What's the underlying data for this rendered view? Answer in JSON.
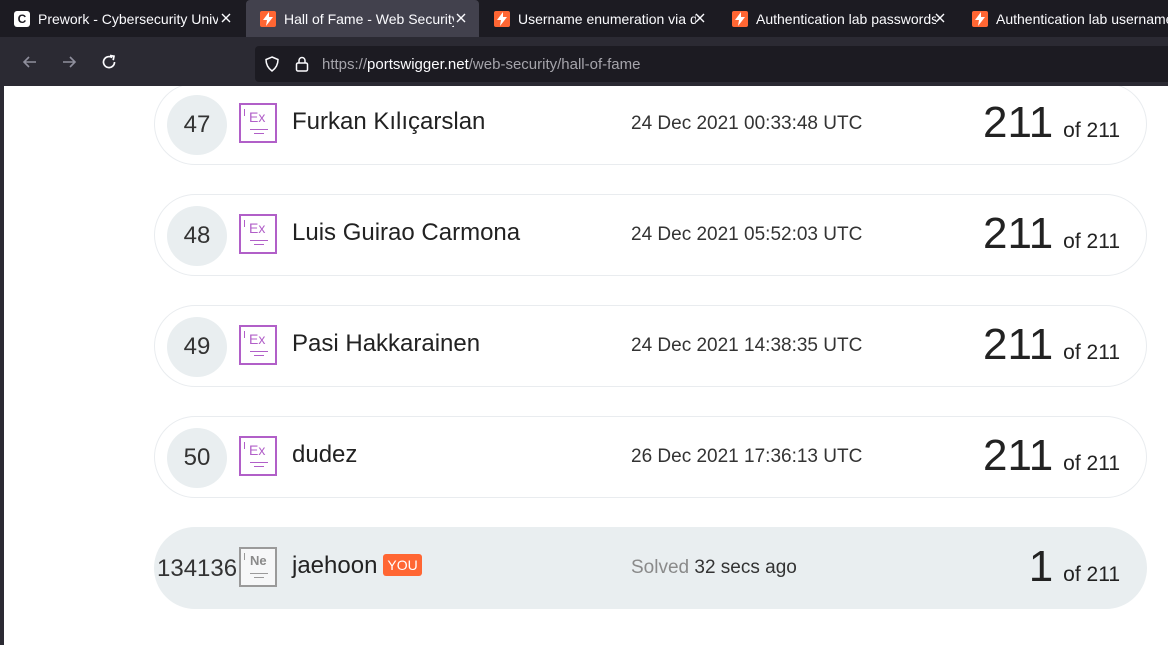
{
  "browser": {
    "tabs": [
      {
        "title": "Prework - Cybersecurity Univers",
        "favicon": "c-logo-icon",
        "active": false
      },
      {
        "title": "Hall of Fame - Web Security Ac",
        "favicon": "portswigger-icon",
        "active": true
      },
      {
        "title": "Username enumeration via diff",
        "favicon": "portswigger-icon",
        "active": false
      },
      {
        "title": "Authentication lab passwords |",
        "favicon": "portswigger-icon",
        "active": false
      },
      {
        "title": "Authentication lab usernames",
        "favicon": "portswigger-icon",
        "active": false
      }
    ],
    "url": {
      "scheme": "https://",
      "host": "portswigger.net",
      "path": "/web-security/hall-of-fame"
    }
  },
  "leaderboard": {
    "rows": [
      {
        "rank": "47",
        "badge": "Ex",
        "name": "Furkan Kılıçarslan",
        "date": "24 Dec 2021 00:33:48 UTC",
        "score": "211",
        "of": "of 211"
      },
      {
        "rank": "48",
        "badge": "Ex",
        "name": "Luis Guirao Carmona",
        "date": "24 Dec 2021 05:52:03 UTC",
        "score": "211",
        "of": "of 211"
      },
      {
        "rank": "49",
        "badge": "Ex",
        "name": "Pasi Hakkarainen",
        "date": "24 Dec 2021 14:38:35 UTC",
        "score": "211",
        "of": "of 211"
      },
      {
        "rank": "50",
        "badge": "Ex",
        "name": "dudez",
        "date": "26 Dec 2021 17:36:13 UTC",
        "score": "211",
        "of": "of 211"
      }
    ],
    "you": {
      "rank": "134136",
      "badge": "Ne",
      "name": "jaehoon",
      "tag": "YOU",
      "solved_label": "Solved",
      "solved_time": "32 secs ago",
      "score": "1",
      "of": "of 211"
    }
  },
  "colors": {
    "expert_badge": "#b15fc8",
    "you_tag": "#ff6633",
    "you_row_bg": "#e9eef0"
  }
}
